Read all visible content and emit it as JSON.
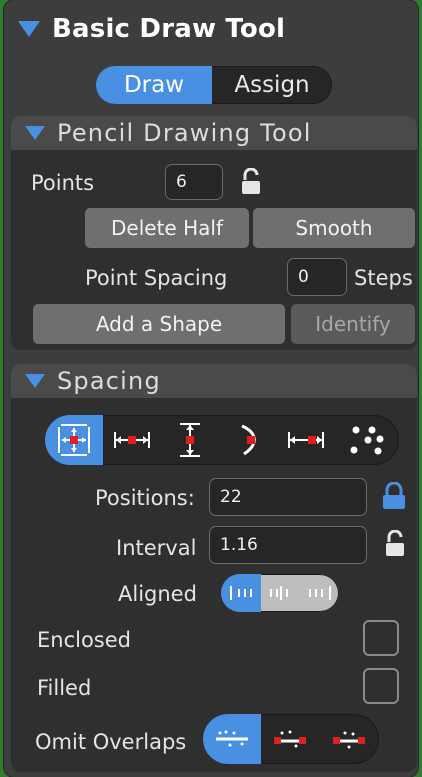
{
  "window": {
    "title": "Basic Draw Tool"
  },
  "mode_tabs": [
    {
      "label": "Draw",
      "active": true
    },
    {
      "label": "Assign",
      "active": false
    }
  ],
  "pencil": {
    "title": "Pencil Drawing Tool",
    "points_label": "Points",
    "points_value": "6",
    "delete_half_label": "Delete Half",
    "smooth_label": "Smooth",
    "point_spacing_label": "Point Spacing",
    "point_spacing_value": "0",
    "steps_label": "Steps",
    "add_shape_label": "Add a Shape",
    "identify_label": "Identify"
  },
  "spacing": {
    "title": "Spacing",
    "modes": [
      {
        "icon": "fill-both-axes-icon",
        "active": true
      },
      {
        "icon": "horizontal-spacing-icon",
        "active": false
      },
      {
        "icon": "vertical-spacing-icon",
        "active": false
      },
      {
        "icon": "curve-spacing-icon",
        "active": false
      },
      {
        "icon": "horizontal-edge-spacing-icon",
        "active": false
      },
      {
        "icon": "scatter-dots-icon",
        "active": false
      }
    ],
    "positions_label": "Positions:",
    "positions_value": "22",
    "interval_label": "Interval",
    "interval_value": "1.16",
    "aligned_label": "Aligned",
    "enclosed_label": "Enclosed",
    "enclosed_checked": false,
    "filled_label": "Filled",
    "filled_checked": false,
    "omit_overlaps_label": "Omit Overlaps"
  },
  "colors": {
    "accent": "#4a90e2",
    "panel": "#3d3d3d",
    "red_marker": "#e02020"
  }
}
